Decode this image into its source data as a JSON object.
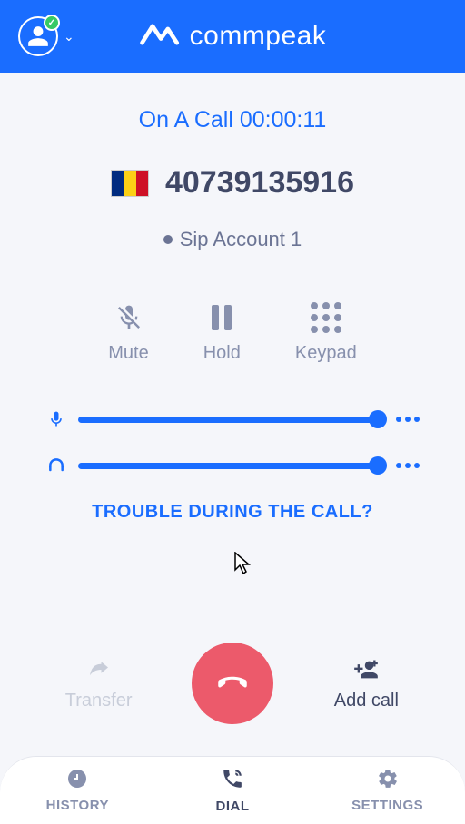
{
  "header": {
    "brand": "commpeak"
  },
  "call": {
    "status_prefix": "On A Call",
    "timer": "00:00:11",
    "number": "40739135916",
    "sip": "Sip Account 1"
  },
  "controls": {
    "mute": "Mute",
    "hold": "Hold",
    "keypad": "Keypad"
  },
  "trouble": "TROUBLE DURING THE CALL?",
  "actions": {
    "transfer": "Transfer",
    "add_call": "Add call"
  },
  "tabs": {
    "history": "HISTORY",
    "dial": "DIAL",
    "settings": "SETTINGS"
  }
}
